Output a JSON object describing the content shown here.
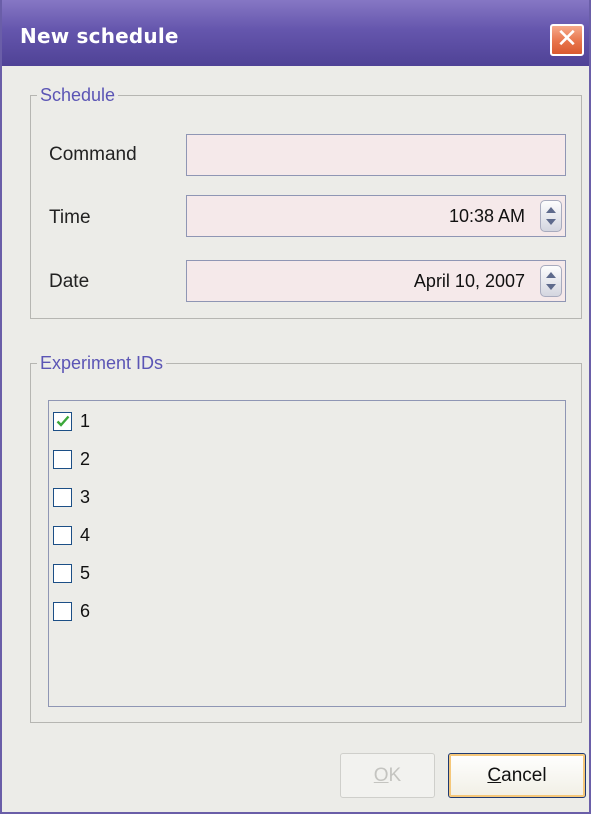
{
  "window": {
    "title": "New schedule",
    "close_symbol": "✕"
  },
  "schedule": {
    "group_title": "Schedule",
    "command": {
      "label": "Command",
      "value": ""
    },
    "time": {
      "label": "Time",
      "value": "10:38 AM"
    },
    "date": {
      "label": "Date",
      "value": "April 10, 2007"
    }
  },
  "experiments": {
    "group_title": "Experiment IDs",
    "items": [
      {
        "label": "1",
        "checked": true
      },
      {
        "label": "2",
        "checked": false
      },
      {
        "label": "3",
        "checked": false
      },
      {
        "label": "4",
        "checked": false
      },
      {
        "label": "5",
        "checked": false
      },
      {
        "label": "6",
        "checked": false
      }
    ]
  },
  "buttons": {
    "ok": {
      "mnemonic": "O",
      "rest": "K",
      "enabled": false
    },
    "cancel": {
      "mnemonic": "C",
      "rest": "ancel",
      "enabled": true
    }
  },
  "colors": {
    "accent": "#5b55b5",
    "titlebar": "#6556ad",
    "field_bg": "#f5e9ea",
    "check": "#3ca83a"
  },
  "icons": {
    "close": "close-icon",
    "spinner": "spinner-arrows-icon",
    "checkbox_checked": "checkmark-icon"
  }
}
